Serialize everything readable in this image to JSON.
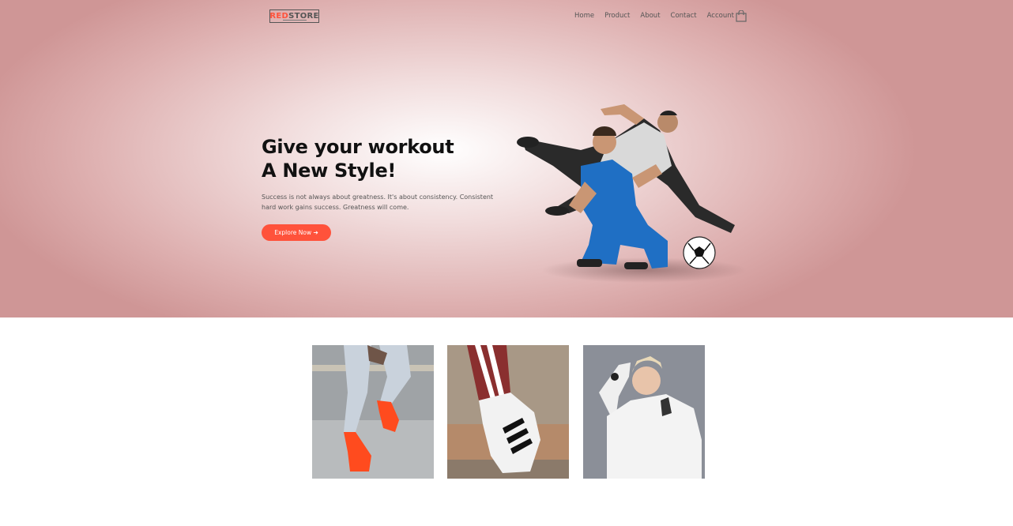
{
  "brand": {
    "logo_red": "RED",
    "logo_dark": "STORE"
  },
  "nav": {
    "items": [
      "Home",
      "Product",
      "About",
      "Contact",
      "Account"
    ],
    "cart_icon": "shopping-bag-icon"
  },
  "hero": {
    "headline_line1": "Give your workout",
    "headline_line2": "A New Style!",
    "description": "Success is not always about greatness. It's about consistency. Consistent hard work gains success. Greatness will come.",
    "cta_label": "Explore Now ➔",
    "accent_color": "#ff523b"
  },
  "featured": {
    "images": [
      "sneakers-orange-photo",
      "sneakers-white-stripes-photo",
      "woman-white-hoodie-photo"
    ]
  }
}
